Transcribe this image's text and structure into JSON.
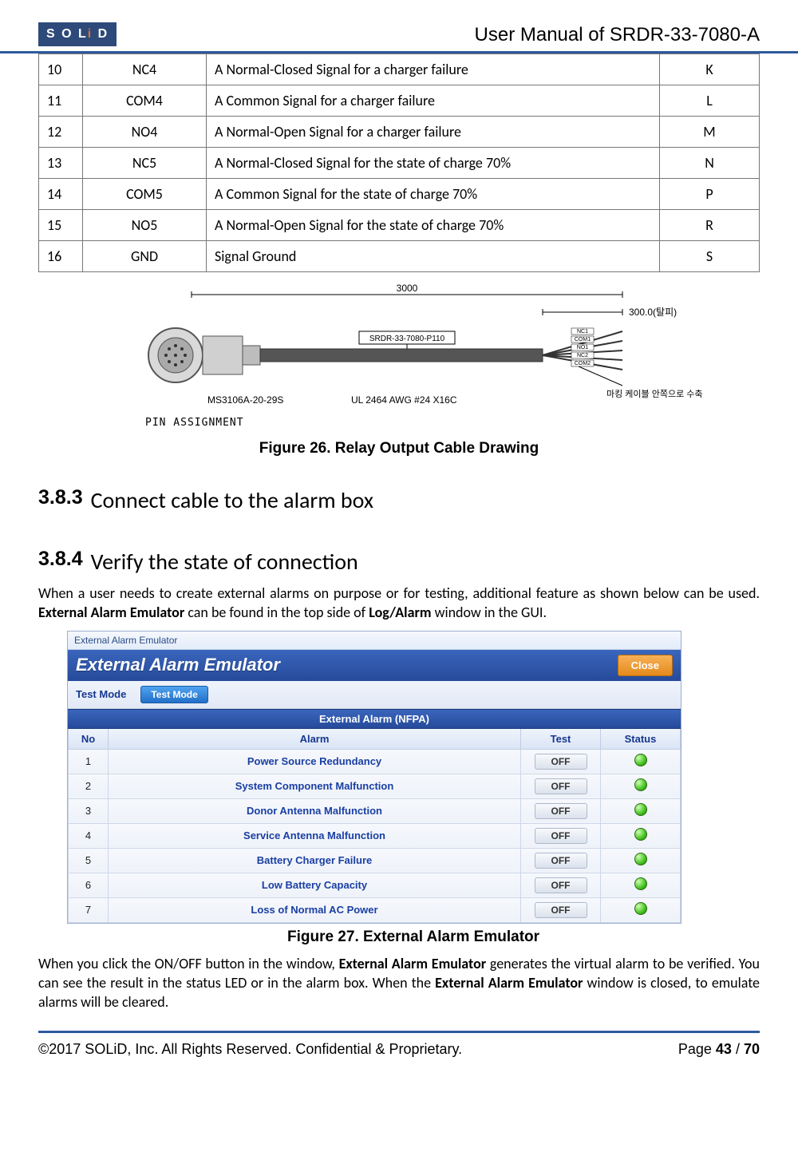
{
  "header": {
    "logo": {
      "text_before_i": "S O L",
      "i": "i",
      "text_after_i": " D"
    },
    "doc_title": "User Manual of SRDR-33-7080-A"
  },
  "pin_table": {
    "rows": [
      {
        "num": "10",
        "name": "NC4",
        "desc": "A Normal-Closed Signal for a charger failure",
        "pin": "K"
      },
      {
        "num": "11",
        "name": "COM4",
        "desc": "A Common Signal for a charger failure",
        "pin": "L"
      },
      {
        "num": "12",
        "name": "NO4",
        "desc": "A Normal-Open Signal for a charger failure",
        "pin": "M"
      },
      {
        "num": "13",
        "name": "NC5",
        "desc": "A Normal-Closed Signal for the state of charge 70%",
        "pin": "N"
      },
      {
        "num": "14",
        "name": "COM5",
        "desc": "A Common Signal for the state of charge 70%",
        "pin": "P"
      },
      {
        "num": "15",
        "name": "NO5",
        "desc": "A Normal-Open Signal for the state of charge 70%",
        "pin": "R"
      },
      {
        "num": "16",
        "name": "GND",
        "desc": "Signal Ground",
        "pin": "S"
      }
    ]
  },
  "cable_drawing": {
    "total_length": "3000",
    "strip_length": "300.0(탈피)",
    "connector": "MS3106A-20-29S",
    "cable_spec": "UL 2464 AWG #24 X16C",
    "part_label": "SRDR-33-7080-P110",
    "marking_note": "마킹  케이블 안쪽으로 수축",
    "pin_assignment_label": "PIN  ASSIGNMENT",
    "wire_labels": [
      "NC1",
      "COM1",
      "NO1",
      "NC2",
      "COM2"
    ]
  },
  "fig26_caption": "Figure 26. Relay Output Cable Drawing",
  "sec383": {
    "num": "3.8.3",
    "title": "Connect cable to the alarm box"
  },
  "sec384": {
    "num": "3.8.4",
    "title": "Verify the state of connection"
  },
  "para384_a": "When a user needs to create external alarms on purpose or for testing, additional feature as shown below can be used. ",
  "para384_b": "External Alarm Emulator",
  "para384_c": " can be found in the top side of ",
  "para384_d": "Log/Alarm",
  "para384_e": " window in the GUI.",
  "gui": {
    "win_title": "External Alarm Emulator",
    "banner_title": "External Alarm Emulator",
    "close_label": "Close",
    "testmode_label": "Test Mode",
    "testmode_btn": "Test Mode",
    "section_header": "External Alarm (NFPA)",
    "cols": {
      "no": "No",
      "alarm": "Alarm",
      "test": "Test",
      "status": "Status"
    },
    "off_label": "OFF",
    "alarms": [
      {
        "no": "1",
        "name": "Power Source Redundancy"
      },
      {
        "no": "2",
        "name": "System Component Malfunction"
      },
      {
        "no": "3",
        "name": "Donor Antenna Malfunction"
      },
      {
        "no": "4",
        "name": "Service Antenna Malfunction"
      },
      {
        "no": "5",
        "name": "Battery Charger Failure"
      },
      {
        "no": "6",
        "name": "Low Battery Capacity"
      },
      {
        "no": "7",
        "name": "Loss of Normal AC Power"
      }
    ]
  },
  "fig27_caption": "Figure 27. External Alarm Emulator",
  "para_after_a": "When you click the ON/OFF button in the window, ",
  "para_after_b": "External Alarm Emulator",
  "para_after_c": " generates the virtual alarm to be verified. You can see the result in the status LED or in the alarm box. When the ",
  "para_after_d": "External Alarm Emulator",
  "para_after_e": " window is closed, to emulate alarms will be cleared.",
  "footer": {
    "copyright": "©2017 SOLiD, Inc. All Rights Reserved. Confidential & Proprietary.",
    "page_label": "Page ",
    "page_current": "43",
    "page_sep": " / ",
    "page_total": "70"
  }
}
